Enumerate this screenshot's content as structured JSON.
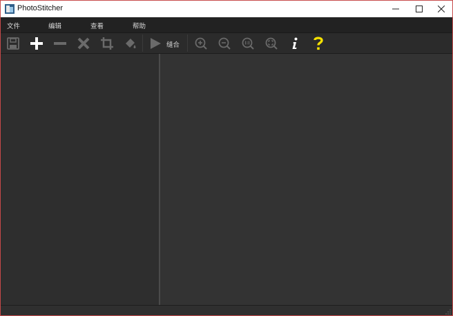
{
  "window": {
    "title": "PhotoStitcher"
  },
  "menu": [
    "文件",
    "编辑",
    "查看",
    "帮助"
  ],
  "toolbar": {
    "stitch_label": "缝合",
    "icons": [
      "save-icon",
      "add-icon",
      "remove-icon",
      "delete-icon",
      "crop-icon",
      "fill-icon",
      "play-icon",
      "zoom-in-icon",
      "zoom-out-icon",
      "zoom-actual-icon",
      "zoom-fit-icon",
      "info-icon",
      "help-icon"
    ]
  },
  "colors": {
    "accent_help": "#f5e100",
    "frame_border": "#c74a4a",
    "panel_dark": "#2e2e2e",
    "canvas": "#333333"
  }
}
